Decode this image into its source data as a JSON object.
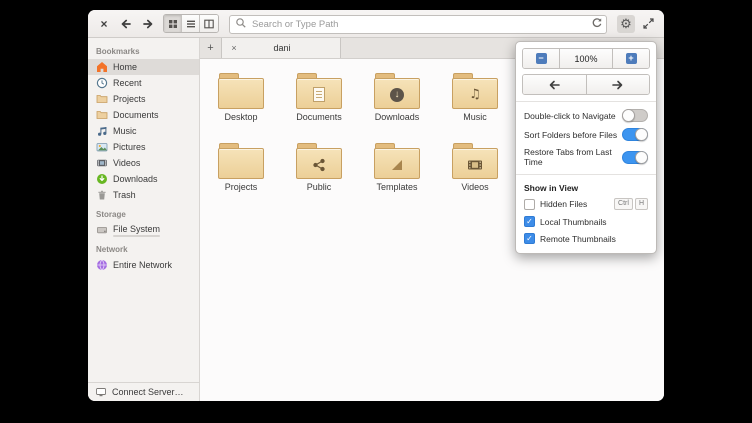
{
  "icons": {
    "close": "×",
    "new_tab": "+",
    "tab_close": "×",
    "gear": "⚙",
    "zoom_out": "−",
    "zoom_in": "+",
    "check": "✓",
    "download_arrow": "↓",
    "music_note": "♫"
  },
  "toolbar": {
    "search_placeholder": "Search or Type Path"
  },
  "sidebar": {
    "sections": [
      {
        "title": "Bookmarks",
        "items": [
          {
            "label": "Home"
          },
          {
            "label": "Recent"
          },
          {
            "label": "Projects"
          },
          {
            "label": "Documents"
          },
          {
            "label": "Music"
          },
          {
            "label": "Pictures"
          },
          {
            "label": "Videos"
          },
          {
            "label": "Downloads"
          },
          {
            "label": "Trash"
          }
        ]
      },
      {
        "title": "Storage",
        "items": [
          {
            "label": "File System"
          }
        ]
      },
      {
        "title": "Network",
        "items": [
          {
            "label": "Entire Network"
          }
        ]
      }
    ],
    "connect_server": "Connect Server…"
  },
  "tabs": {
    "active": "dani"
  },
  "files": [
    {
      "name": "Desktop"
    },
    {
      "name": "Documents"
    },
    {
      "name": "Downloads"
    },
    {
      "name": "Music"
    },
    {
      "name": "Projects"
    },
    {
      "name": "Public"
    },
    {
      "name": "Templates"
    },
    {
      "name": "Videos"
    }
  ],
  "popover": {
    "zoom_level": "100%",
    "toggles": [
      {
        "label": "Double-click to Navigate",
        "on": false
      },
      {
        "label": "Sort Folders before Files",
        "on": true
      },
      {
        "label": "Restore Tabs from Last Time",
        "on": true
      }
    ],
    "section_title": "Show in View",
    "checkboxes": [
      {
        "label": "Hidden Files",
        "checked": false,
        "shortcut": [
          "Ctrl",
          "H"
        ]
      },
      {
        "label": "Local Thumbnails",
        "checked": true
      },
      {
        "label": "Remote Thumbnails",
        "checked": true
      }
    ]
  },
  "colors": {
    "accent": "#3d95f0",
    "folder": "#eccf97",
    "selection": "#dedbd8"
  }
}
